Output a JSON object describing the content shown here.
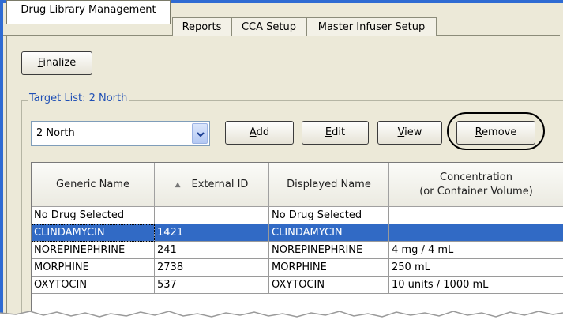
{
  "tabs": [
    {
      "label": "Drug Library Management",
      "active": true
    },
    {
      "label": "Reports",
      "active": false
    },
    {
      "label": "CCA Setup",
      "active": false
    },
    {
      "label": "Master Infuser Setup",
      "active": false
    }
  ],
  "toolbar": {
    "finalize_prefix": "",
    "finalize_mnemonic": "F",
    "finalize_rest": "inalize"
  },
  "target_list": {
    "label": "Target List: 2 North",
    "selected": "2 North"
  },
  "buttons": {
    "add": {
      "mnemonic": "A",
      "rest": "dd"
    },
    "edit": {
      "mnemonic": "E",
      "rest": "dit"
    },
    "view": {
      "mnemonic": "V",
      "rest": "iew"
    },
    "remove": {
      "mnemonic": "R",
      "rest": "emove"
    }
  },
  "table": {
    "columns": [
      {
        "label": "Generic Name"
      },
      {
        "label": "External ID",
        "sort_indicator": "▲"
      },
      {
        "label": "Displayed Name"
      },
      {
        "label_line1": "Concentration",
        "label_line2": "(or Container Volume)"
      }
    ],
    "rows": [
      {
        "generic": "No Drug Selected",
        "external_id": "",
        "displayed": "No Drug Selected",
        "concentration": "",
        "selected": false
      },
      {
        "generic": "CLINDAMYCIN",
        "external_id": "1421",
        "displayed": "CLINDAMYCIN",
        "concentration": "",
        "selected": true
      },
      {
        "generic": "NOREPINEPHRINE",
        "external_id": "241",
        "displayed": "NOREPINEPHRINE",
        "concentration": "4 mg / 4 mL",
        "selected": false
      },
      {
        "generic": "MORPHINE",
        "external_id": "2738",
        "displayed": "MORPHINE",
        "concentration": "250 mL",
        "selected": false
      },
      {
        "generic": "OXYTOCIN",
        "external_id": "537",
        "displayed": "OXYTOCIN",
        "concentration": "10 units / 1000 mL",
        "selected": false
      }
    ]
  },
  "colors": {
    "accent": "#316ac5",
    "window_bg": "#ece9d8",
    "frame_blue": "#2f6bd3"
  }
}
